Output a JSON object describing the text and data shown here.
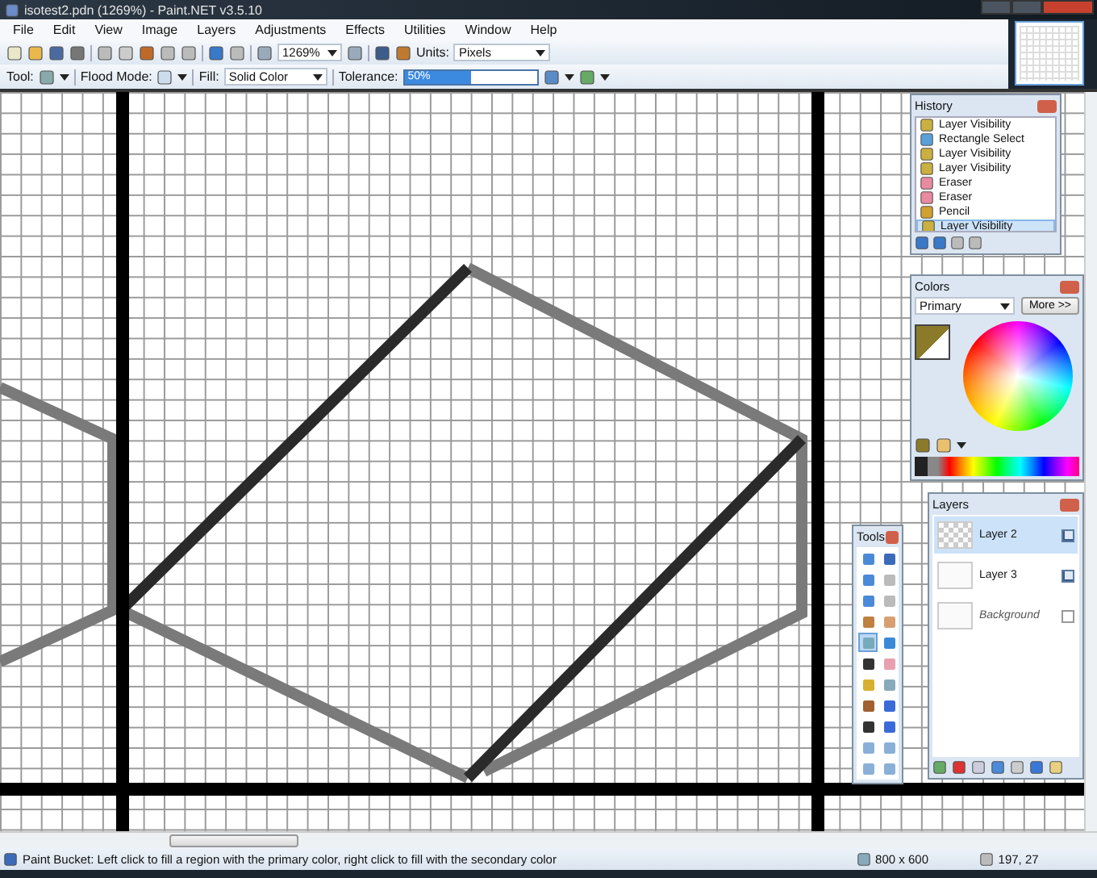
{
  "window": {
    "title": "isotest2.pdn (1269%) - Paint.NET v3.5.10"
  },
  "menu": [
    "File",
    "Edit",
    "View",
    "Image",
    "Layers",
    "Adjustments",
    "Effects",
    "Utilities",
    "Window",
    "Help"
  ],
  "toolbar": {
    "zoom": "1269%",
    "units_label": "Units:",
    "units": "Pixels"
  },
  "tool_options": {
    "tool_label": "Tool:",
    "flood_mode_label": "Flood Mode:",
    "fill_label": "Fill:",
    "fill": "Solid Color",
    "tolerance_label": "Tolerance:",
    "tolerance": {
      "reading": "50%",
      "level": 0.5
    }
  },
  "history": {
    "title": "History",
    "items": [
      {
        "label": "Layer Visibility",
        "selected": false
      },
      {
        "label": "Rectangle Select",
        "selected": false
      },
      {
        "label": "Layer Visibility",
        "selected": false
      },
      {
        "label": "Layer Visibility",
        "selected": false
      },
      {
        "label": "Eraser",
        "selected": false
      },
      {
        "label": "Eraser",
        "selected": false
      },
      {
        "label": "Pencil",
        "selected": false
      },
      {
        "label": "Layer Visibility",
        "selected": true
      }
    ]
  },
  "colors": {
    "title": "Colors",
    "mode": "Primary",
    "more_button": "More >>"
  },
  "tools": {
    "title": "Tools",
    "items": [
      {
        "selected": false
      },
      {
        "selected": false
      },
      {
        "selected": false
      },
      {
        "selected": false
      },
      {
        "selected": false
      },
      {
        "selected": false
      },
      {
        "selected": false
      },
      {
        "selected": false
      },
      {
        "selected": true
      },
      {
        "selected": false
      },
      {
        "selected": false
      },
      {
        "selected": false
      },
      {
        "selected": false
      },
      {
        "selected": false
      },
      {
        "selected": false
      },
      {
        "selected": false
      },
      {
        "selected": false
      },
      {
        "selected": false
      },
      {
        "selected": false
      },
      {
        "selected": false
      },
      {
        "selected": false
      },
      {
        "selected": false
      }
    ]
  },
  "layers": {
    "title": "Layers",
    "items": [
      {
        "name": "Layer 2",
        "visible": true,
        "selected": true
      },
      {
        "name": "Layer 3",
        "visible": true,
        "selected": false
      },
      {
        "name": "Background",
        "visible": false,
        "selected": false
      }
    ]
  },
  "status_bar": {
    "message": "Paint Bucket: Left click to fill a region with the primary color, right click to fill with the secondary color",
    "image_size": "800 x 600",
    "cursor_position": "197, 27"
  }
}
